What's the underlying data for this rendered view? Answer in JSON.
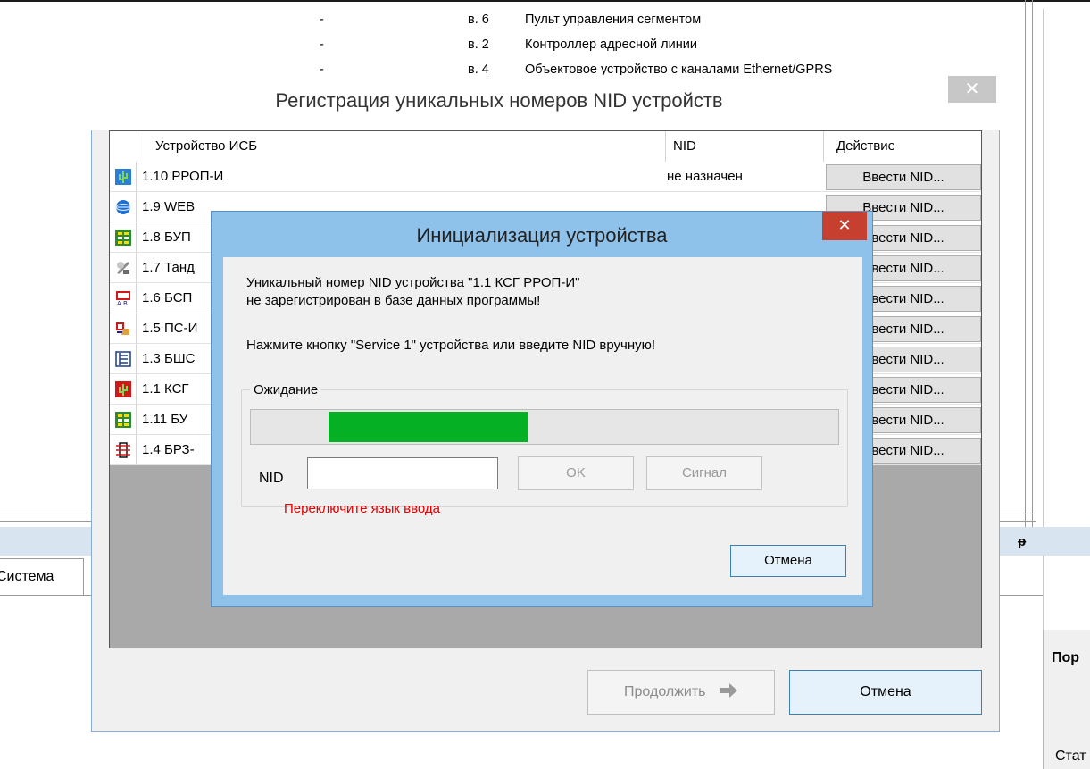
{
  "background": {
    "rows": [
      {
        "c1": "-",
        "c2": "в. 6",
        "c3": "Пульт управления сегментом"
      },
      {
        "c1": "-",
        "c2": "в. 2",
        "c3": "Контроллер адресной линии"
      },
      {
        "c1": "-",
        "c2": "в. 4",
        "c3": "Объектовое устройство с каналами Ethernet/GPRS"
      }
    ],
    "tab_label": "Система",
    "pin_glyph": "ᵽ",
    "right_panel_header": "Пор",
    "right_panel_footer": "Стат"
  },
  "outer_dialog": {
    "title": "Регистрация уникальных номеров NID устройств",
    "close_glyph": "✕",
    "columns": [
      "Устройство ИСБ",
      "NID",
      "Действие"
    ],
    "rows": [
      {
        "icon": "cactus-icon",
        "name": "1.10 РРОП-И",
        "nid": "не назначен",
        "action": "Ввести NID..."
      },
      {
        "icon": "globe-icon",
        "name": "1.9 WEB",
        "nid": "",
        "action": "Ввести NID..."
      },
      {
        "icon": "grid-panel-icon",
        "name": "1.8 БУП",
        "nid": "",
        "action": "Ввести NID..."
      },
      {
        "icon": "satellite-icon",
        "name": "1.7 Танд",
        "nid": "",
        "action": "Ввести NID..."
      },
      {
        "icon": "ab-module-icon",
        "name": "1.6 БСП",
        "nid": "",
        "action": "Ввести NID..."
      },
      {
        "icon": "alarm-hand-icon",
        "name": "1.5 ПС-И",
        "nid": "",
        "action": "Ввести NID..."
      },
      {
        "icon": "bus-module-icon",
        "name": "1.3 БШС",
        "nid": "",
        "action": "Ввести NID..."
      },
      {
        "icon": "cactus-red-icon",
        "name": "1.1 КСГ",
        "nid": "",
        "action": "Ввести NID..."
      },
      {
        "icon": "grid-panel-icon",
        "name": "1.11 БУ",
        "nid": "",
        "action": "Ввести NID..."
      },
      {
        "icon": "relay-block-icon",
        "name": "1.4 БРЗ-",
        "nid": "",
        "action": "Ввести NID..."
      }
    ],
    "continue_label": "Продолжить",
    "continue_icon": "arrow-right-icon",
    "cancel_label": "Отмена"
  },
  "inner_dialog": {
    "title": "Инициализация устройства",
    "close_glyph": "✕",
    "message_line1": "Уникальный номер NID устройства \"1.1 КСГ РРОП-И\"",
    "message_line2": "не зарегистрирован в базе данных программы!",
    "message_line3": "Нажмите кнопку \"Service 1\" устройства или введите NID вручную!",
    "group_label": "Ожидание",
    "progress": {
      "start_fraction": 0.13,
      "end_fraction": 0.47,
      "color": "#06b025"
    },
    "nid_label": "NID",
    "nid_value": "",
    "ok_label": "OK",
    "signal_label": "Сигнал",
    "warning": "Переключите язык ввода",
    "cancel_label": "Отмена"
  },
  "colors": {
    "title_close_active": "#c7402f",
    "dialog_frame": "#8fc2ea",
    "warning_text": "#e00000",
    "progress_green": "#06b025"
  }
}
